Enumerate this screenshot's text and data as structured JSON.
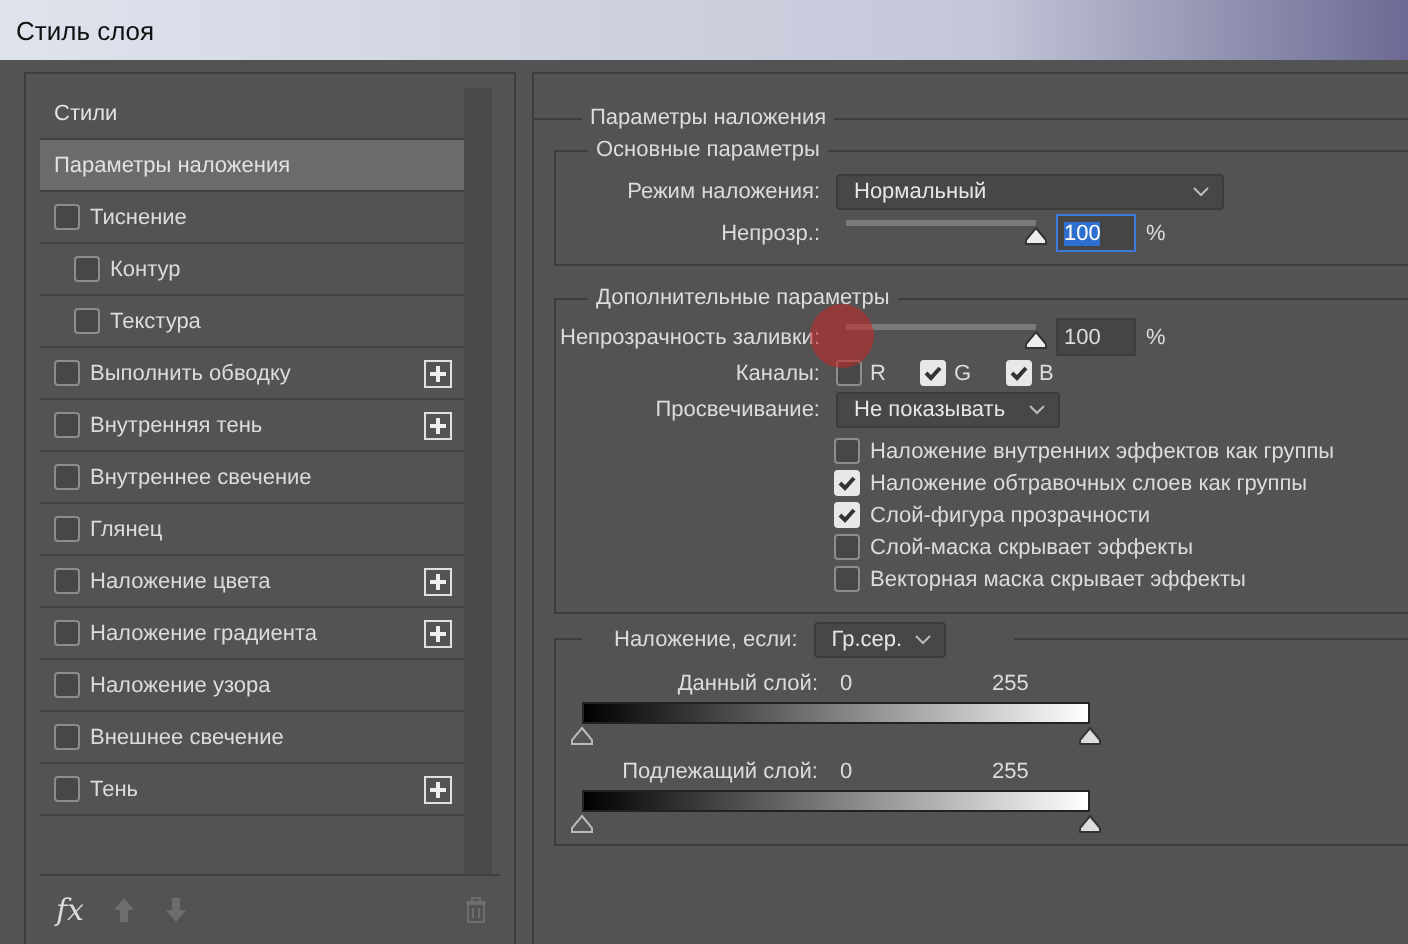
{
  "window": {
    "title": "Стиль слоя"
  },
  "sidebar": {
    "items": [
      {
        "kind": "header",
        "label": "Стили",
        "selected": false
      },
      {
        "kind": "header",
        "label": "Параметры наложения",
        "selected": true
      },
      {
        "kind": "effect",
        "label": "Тиснение",
        "selected": false,
        "checked": false,
        "addable": false,
        "children": [
          {
            "kind": "effect",
            "label": "Контур",
            "selected": false,
            "checked": false,
            "addable": false
          },
          {
            "kind": "effect",
            "label": "Текстура",
            "selected": false,
            "checked": false,
            "addable": false
          }
        ]
      },
      {
        "kind": "effect",
        "label": "Выполнить обводку",
        "selected": false,
        "checked": false,
        "addable": true
      },
      {
        "kind": "effect",
        "label": "Внутренняя тень",
        "selected": false,
        "checked": false,
        "addable": true
      },
      {
        "kind": "effect",
        "label": "Внутреннее свечение",
        "selected": false,
        "checked": false,
        "addable": false
      },
      {
        "kind": "effect",
        "label": "Глянец",
        "selected": false,
        "checked": false,
        "addable": false
      },
      {
        "kind": "effect",
        "label": "Наложение цвета",
        "selected": false,
        "checked": false,
        "addable": true
      },
      {
        "kind": "effect",
        "label": "Наложение градиента",
        "selected": false,
        "checked": false,
        "addable": true
      },
      {
        "kind": "effect",
        "label": "Наложение узора",
        "selected": false,
        "checked": false,
        "addable": false
      },
      {
        "kind": "effect",
        "label": "Внешнее свечение",
        "selected": false,
        "checked": false,
        "addable": false
      },
      {
        "kind": "effect",
        "label": "Тень",
        "selected": false,
        "checked": false,
        "addable": true
      }
    ],
    "toolbar": {
      "fx": "fx"
    }
  },
  "blending": {
    "title": "Параметры наложения",
    "general": {
      "title": "Основные параметры",
      "blend_mode_label": "Режим наложения:",
      "blend_mode": "Нормальный",
      "opacity_label": "Непрозр.:",
      "opacity": {
        "level": 1,
        "value": "100",
        "selected": true,
        "unit": "%"
      }
    },
    "advanced": {
      "title": "Дополнительные параметры",
      "fill_opacity_label": "Непрозрачность заливки:",
      "fill_opacity": {
        "level": 1,
        "value": "100",
        "selected": false,
        "unit": "%"
      },
      "channels_label": "Каналы:",
      "channels": [
        {
          "label": "R",
          "checked": false
        },
        {
          "label": "G",
          "checked": true
        },
        {
          "label": "B",
          "checked": true
        }
      ],
      "knockout_label": "Просвечивание:",
      "knockout": "Не показывать",
      "options": [
        {
          "label": "Наложение внутренних эффектов как группы",
          "checked": false
        },
        {
          "label": "Наложение обтравочных слоев как группы",
          "checked": true
        },
        {
          "label": "Слой-фигура прозрачности",
          "checked": true
        },
        {
          "label": "Слой-маска скрывает эффекты",
          "checked": false
        },
        {
          "label": "Векторная маска скрывает эффекты",
          "checked": false
        }
      ]
    },
    "blend_if": {
      "label": "Наложение, если:",
      "value": "Гр.сер.",
      "ranges": [
        {
          "label": "Данный слой:",
          "low": "0",
          "high": "255"
        },
        {
          "label": "Подлежащий слой:",
          "low": "0",
          "high": "255"
        }
      ]
    }
  }
}
